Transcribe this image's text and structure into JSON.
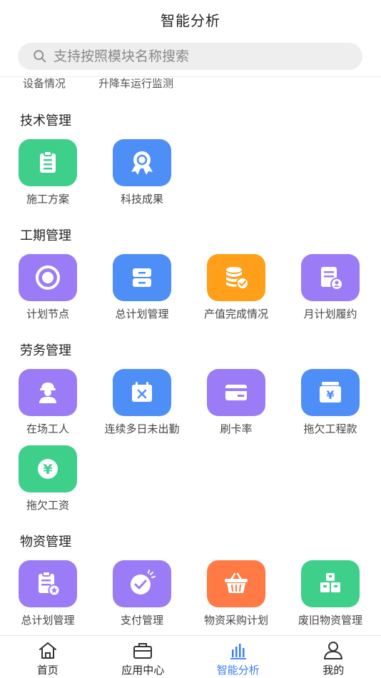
{
  "header": {
    "title": "智能分析"
  },
  "search": {
    "placeholder": "支持按照模块名称搜索"
  },
  "partial_row": [
    "设备情况",
    "升降车运行监测"
  ],
  "sections": [
    {
      "title": "技术管理",
      "items": [
        "施工方案",
        "科技成果"
      ]
    },
    {
      "title": "工期管理",
      "items": [
        "计划节点",
        "总计划管理",
        "产值完成情况",
        "月计划履约"
      ]
    },
    {
      "title": "劳务管理",
      "items": [
        "在场工人",
        "连续多日未出勤",
        "刷卡率",
        "拖欠工程款",
        "拖欠工资"
      ]
    },
    {
      "title": "物资管理",
      "items": [
        "总计划管理",
        "支付管理",
        "物资采购计划",
        "废旧物资管理"
      ]
    }
  ],
  "tabs": [
    "首页",
    "应用中心",
    "智能分析",
    "我的"
  ],
  "active_tab": "智能分析",
  "colors": {
    "green": "#3ecf8a",
    "blue": "#4e8ef7",
    "purple": "#9b7cf6",
    "orange": "#ff9f1a",
    "orange_red": "#ff7a45",
    "active": "#3b7ff0"
  }
}
